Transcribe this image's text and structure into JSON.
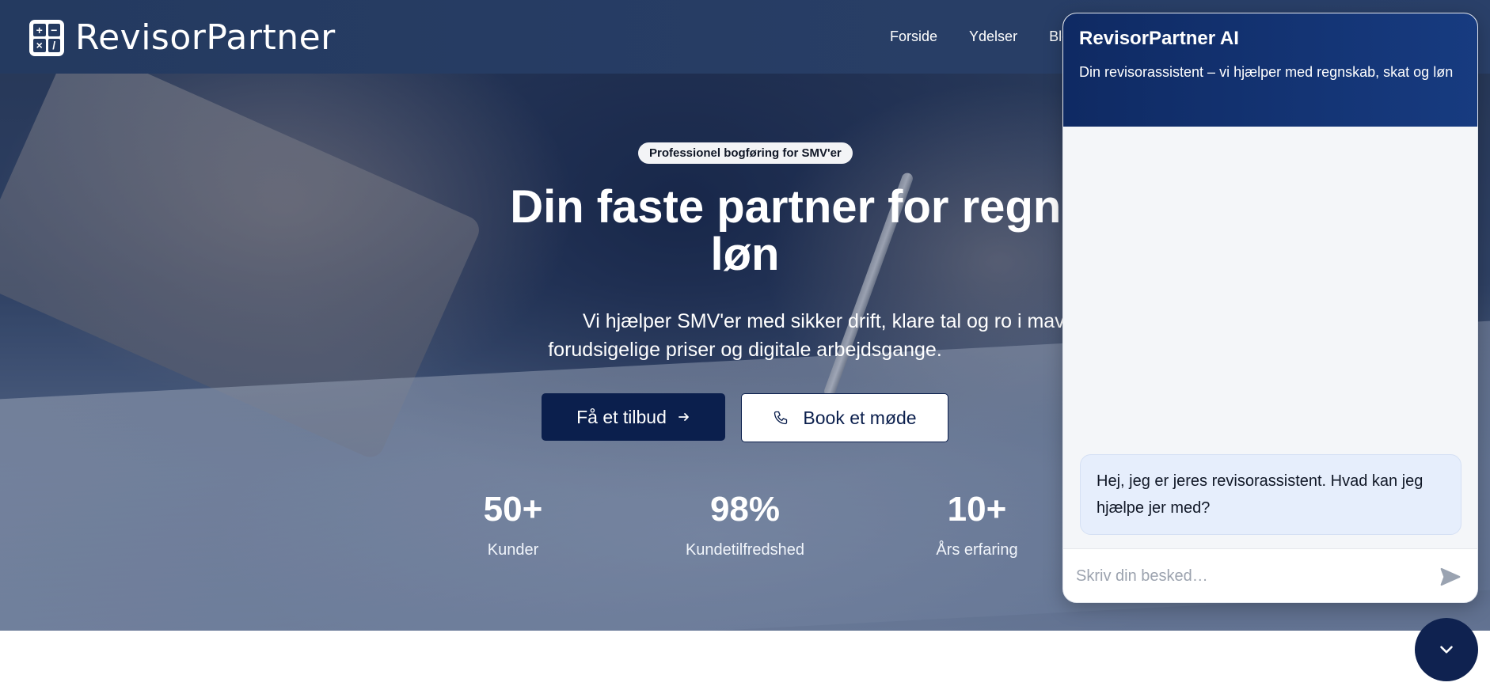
{
  "brand": {
    "name": "RevisorPartner",
    "logo_symbols": [
      "+",
      "−",
      "×",
      "/"
    ]
  },
  "nav": {
    "items": [
      {
        "label": "Forside"
      },
      {
        "label": "Ydelser"
      },
      {
        "label": "Blog"
      }
    ]
  },
  "hero": {
    "badge": "Professionel bogføring for SMV'er",
    "title_line1": "Din faste partner for regnskab, skat og",
    "title_line2": "løn",
    "subtitle_line1": "Vi hjælper SMV'er med sikker drift, klare tal og ro i maven. Fast kontaktperson,",
    "subtitle_line2": "forudsigelige priser og digitale arbejdsgange.",
    "cta_primary": "Få et tilbud",
    "cta_secondary": "Book et møde",
    "stats": [
      {
        "value": "50+",
        "label": "Kunder"
      },
      {
        "value": "98%",
        "label": "Kundetilfredshed"
      },
      {
        "value": "10+",
        "label": "Års erfaring"
      }
    ]
  },
  "chat": {
    "title": "RevisorPartner AI",
    "subtitle": "Din revisorassistent – vi hjælper med regnskab, skat og løn",
    "messages": [
      {
        "role": "assistant",
        "text": "Hej, jeg er jeres revisorassistent. Hvad kan jeg hjælpe jer med?"
      }
    ],
    "input_placeholder": "Skriv din besked…",
    "input_value": ""
  },
  "colors": {
    "navy": "#0b1f4d",
    "nav_bg": "#243a60",
    "chat_header": "#0f2a63",
    "bubble": "#e6eefc"
  }
}
